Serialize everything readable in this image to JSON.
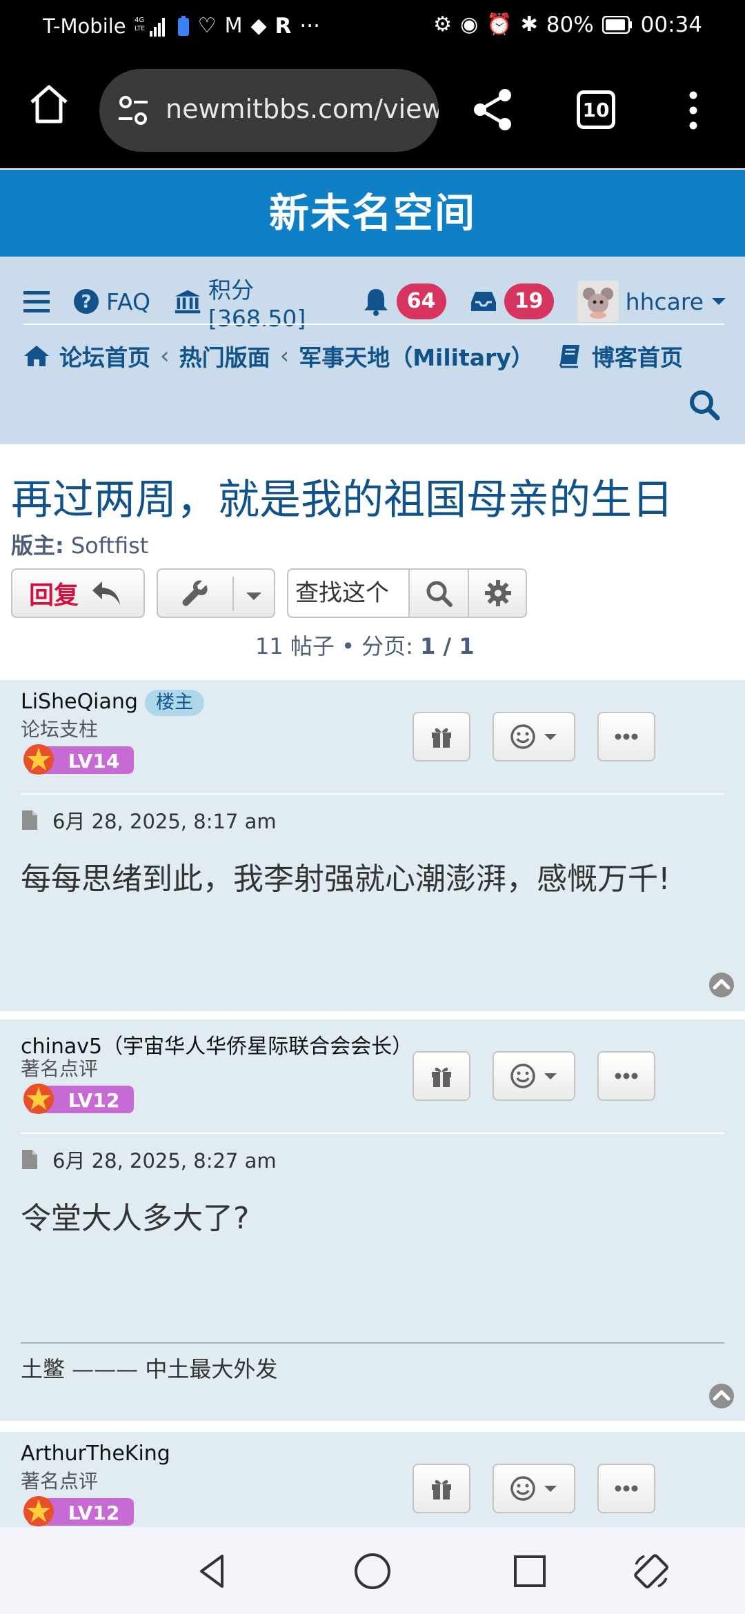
{
  "status_bar": {
    "carrier": "T-Mobile",
    "network": "4G LTE",
    "letter_r": "R",
    "overflow": "···",
    "battery": "80%",
    "time": "00:34"
  },
  "browser": {
    "url": "newmitbbs.com/view",
    "tab_count": "10"
  },
  "site": {
    "title": "新未名空间"
  },
  "nav": {
    "faq": "FAQ",
    "points": "积分[368.50]",
    "notifications": "64",
    "messages": "19",
    "username": "hhcare"
  },
  "breadcrumb": {
    "home": "论坛首页",
    "hot": "热门版面",
    "board": "军事天地（Military）",
    "blog": "博客首页"
  },
  "topic": {
    "title": "再过两周，就是我的祖国母亲的生日",
    "moderator_label": "版主:",
    "moderator_name": "Softfist",
    "reply_label": "回复",
    "search_placeholder": "查找这个",
    "pagination": "11 帖子  •  分页: ",
    "page": "1 / 1"
  },
  "posts": [
    {
      "author": "LiSheQiang",
      "owner_tag": "楼主",
      "rank": "论坛支柱",
      "level": "LV14",
      "date": "6月 28, 2025, 8:17 am",
      "content": "每每思绪到此，我李射强就心潮澎湃，感慨万千!"
    },
    {
      "author": "chinav5（宇宙华人华侨星际联合会会长）",
      "rank": "著名点评",
      "level": "LV12",
      "date": "6月 28, 2025, 8:27 am",
      "content": "令堂大人多大了?",
      "signature": "土鳖 ——— 中土最大外发"
    },
    {
      "author": "ArthurTheKing",
      "rank": "著名点评",
      "level": "LV12"
    }
  ],
  "colors": {
    "header": "#0f7fc6",
    "nav_bg": "#cadceb",
    "link": "#105289",
    "badge": "#d7345f",
    "reply": "#d31141",
    "post_bg": "#e1ebf2"
  }
}
